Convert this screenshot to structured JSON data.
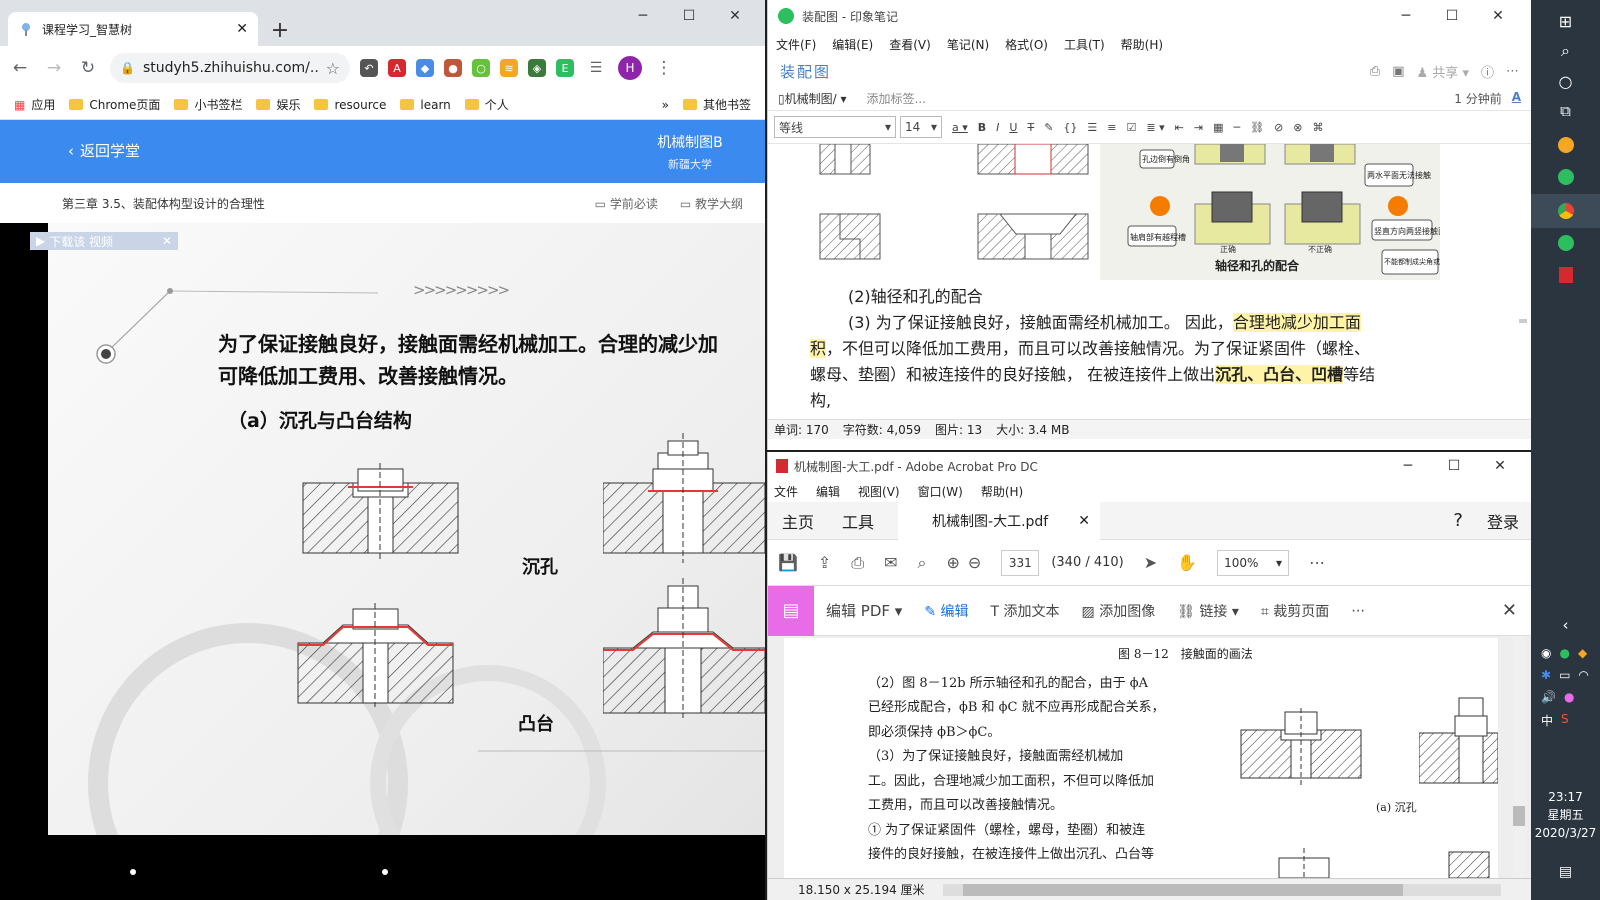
{
  "chrome": {
    "tab_title": "课程学习_智慧树",
    "url": "studyh5.zhihuishu.com/...",
    "profile_initial": "H",
    "bookmarks": [
      "应用",
      "Chrome页面",
      "小书签栏",
      "娱乐",
      "resource",
      "learn",
      "个人"
    ],
    "bookmarks_more": "»",
    "other_bookmarks": "其他书签",
    "back_label": "返回学堂",
    "course_name": "机械制图B",
    "university": "新疆大学",
    "chapter": "第三章 3.5、装配体构型设计的合理性",
    "must_read": "学前必读",
    "syllabus": "教学大纲",
    "download_video": "下载该 视频",
    "video": {
      "heading_line1": "为了保证接触良好，接触面需经机械加工。合理的减少加",
      "heading_line2": "可降低加工费用、改善接触情况。",
      "subheading": "（a）沉孔与凸台结构",
      "label_countersink": "沉孔",
      "label_boss": "凸台",
      "arrows": ">>>>>>>>>"
    }
  },
  "evernote": {
    "window_title": "装配图 - 印象笔记",
    "menu": [
      "文件(F)",
      "编辑(E)",
      "查看(V)",
      "笔记(N)",
      "格式(O)",
      "工具(T)",
      "帮助(H)"
    ],
    "note_title": "装配图",
    "share": "共享",
    "notebook": "机械制图/",
    "add_tag": "添加标签...",
    "time_ago": "1 分钟前",
    "font": "等线",
    "font_size": "14",
    "image_caption": "轴径和孔的配合",
    "image_callouts": [
      "孔边倒有倒角",
      "两水平面无法接触",
      "轴肩部有越程槽",
      "竖直方向两竖接触面",
      "不能都制成尖角或圆角",
      "正确",
      "不正确"
    ],
    "para1": "(2)轴径和孔的配合",
    "para2_a": "(3) 为了保证接触良好，接触面需经机械加工。 因此，",
    "para2_hl1a": "合理地减少加工面",
    "para2_hl1b": "积",
    "para2_b": "，不但可以降低加工费用，而且可以改善接触情况。为了保证紧固件（螺栓、",
    "para2_c": "螺母、垫圈）和被连接件的良好接触， 在被连接件上做出",
    "para2_hl2": "沉孔、凸台、凹槽",
    "para2_d": "等结",
    "para2_e": "构,",
    "status": {
      "words": "单词: 170",
      "chars": "字符数: 4,059",
      "images": "图片: 13",
      "size": "大小: 3.4 MB"
    }
  },
  "acrobat": {
    "window_title": "机械制图-大工.pdf - Adobe Acrobat Pro DC",
    "menu": [
      "文件",
      "编辑",
      "视图(V)",
      "窗口(W)",
      "帮助(H)"
    ],
    "tab_home": "主页",
    "tab_tools": "工具",
    "tab_doc": "机械制图-大工.pdf",
    "login": "登录",
    "page_num": "331",
    "page_count": "(340 / 410)",
    "zoom": "100%",
    "edit_pdf": "编辑 PDF",
    "edit": "编辑",
    "add_text": "添加文本",
    "add_image": "添加图像",
    "link": "链接",
    "crop": "裁剪页面",
    "fig_caption": "图 8－12　接触面的画法",
    "lines": [
      "（2）图 8－12b 所示轴径和孔的配合，由于 ϕA",
      "已经形成配合，ϕB 和 ϕC 就不应再形成配合关系，",
      "即必须保持 ϕB＞ϕC。",
      "（3）为了保证接触良好，接触面需经机械加",
      "工。因此，合理地减少加工面积，不但可以降低加",
      "工费用，而且可以改善接触情况。",
      "① 为了保证紧固件（螺栓，螺母，垫圈）和被连",
      "接件的良好接触，在被连接件上做出沉孔、凸台等"
    ],
    "fig_label": "(a) 沉孔",
    "page_size": "18.150 x 25.194 厘米"
  },
  "taskbar": {
    "time": "23:17",
    "weekday": "星期五",
    "date": "2020/3/27",
    "ime": "中"
  },
  "colors": {
    "chrome_header_blue": "#3a8af0",
    "evernote_green": "#2dbe60",
    "acrobat_red": "#d7282f",
    "acrobat_pink": "#e86ce8",
    "highlight": "#fff3a8",
    "taskbar": "#2b3540"
  }
}
